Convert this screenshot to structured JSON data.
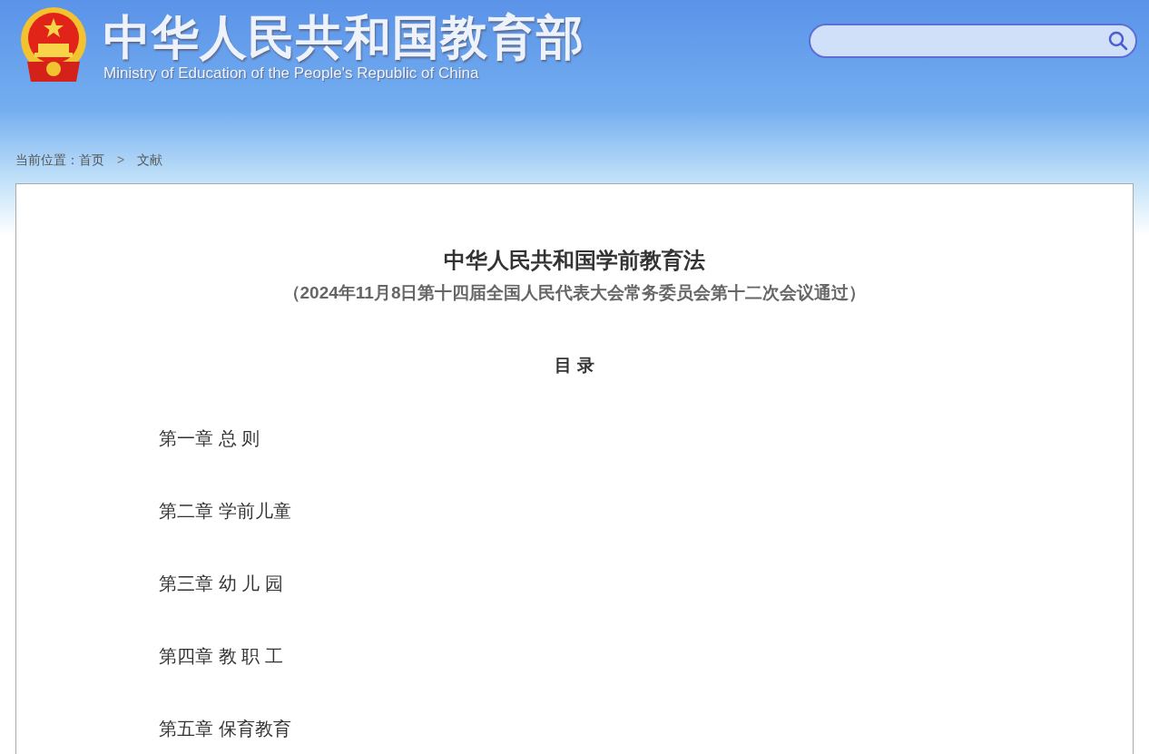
{
  "header": {
    "title": "中华人民共和国教育部",
    "subtitle": "Ministry of Education of the People's Republic of China"
  },
  "breadcrumb": {
    "label": "当前位置：",
    "items": [
      {
        "text": "首页",
        "kind": "link"
      },
      {
        "text": ">",
        "kind": "separator"
      },
      {
        "text": "文献",
        "kind": "current"
      }
    ]
  },
  "document": {
    "title": "中华人民共和国学前教育法",
    "subtitle": "（2024年11月8日第十四届全国人民代表大会常务委员会第十二次会议通过）",
    "toc_heading": "目 录",
    "chapters": [
      "第一章 总 则",
      "第二章 学前儿童",
      "第三章 幼 儿 园",
      "第四章 教 职 工",
      "第五章 保育教育"
    ]
  }
}
